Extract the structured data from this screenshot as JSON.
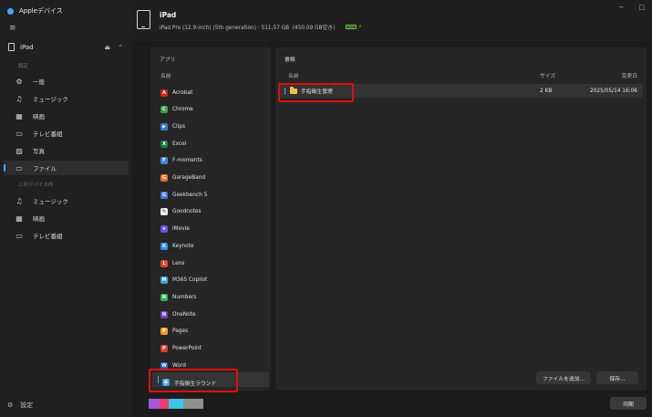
{
  "app": {
    "title": "Appleデバイス"
  },
  "window_controls": {
    "minimize": "−",
    "maximize": "□",
    "close": "✕"
  },
  "sidebar": {
    "device": "iPad",
    "section_settings": "設定",
    "items": [
      {
        "label": "一般",
        "icon": "gear-icon"
      },
      {
        "label": "ミュージック",
        "icon": "music-note-icon"
      },
      {
        "label": "映画",
        "icon": "film-icon"
      },
      {
        "label": "テレビ番組",
        "icon": "tv-icon"
      },
      {
        "label": "写真",
        "icon": "photo-icon"
      },
      {
        "label": "ファイル",
        "icon": "folder-icon",
        "active": true
      }
    ],
    "section_on_device": "このデバイス内",
    "device_items": [
      {
        "label": "ミュージック",
        "icon": "music-note-icon"
      },
      {
        "label": "映画",
        "icon": "film-icon"
      },
      {
        "label": "テレビ番組",
        "icon": "tv-icon"
      }
    ],
    "settings_label": "設定"
  },
  "header": {
    "device_name": "iPad",
    "device_info": "iPad Pro (12.9-inch) (5th generation) · 511.57 GB（450.09 GB空き）"
  },
  "apps_panel": {
    "title": "アプリ",
    "column_name": "名前",
    "apps": [
      {
        "name": "Acrobat",
        "color": "#d9251c",
        "glyph": "A"
      },
      {
        "name": "Chrome",
        "color": "#3c9f44",
        "glyph": "C"
      },
      {
        "name": "Clips",
        "color": "#2f7bd6",
        "glyph": "▶"
      },
      {
        "name": "Excel",
        "color": "#1f7a45",
        "glyph": "X"
      },
      {
        "name": "F-moments",
        "color": "#3a86e8",
        "glyph": "F"
      },
      {
        "name": "GarageBand",
        "color": "#f06b2a",
        "glyph": "G"
      },
      {
        "name": "Geekbench 5",
        "color": "#3a7bd5",
        "glyph": "G"
      },
      {
        "name": "Goodnotes",
        "color": "#e8e8e8",
        "glyph": "✎"
      },
      {
        "name": "iMovie",
        "color": "#6b4de6",
        "glyph": "★"
      },
      {
        "name": "Keynote",
        "color": "#2b8ff0",
        "glyph": "K"
      },
      {
        "name": "Lens",
        "color": "#e2442f",
        "glyph": "L"
      },
      {
        "name": "M365 Copilot",
        "color": "#39a3d9",
        "glyph": "M"
      },
      {
        "name": "Numbers",
        "color": "#2cb24c",
        "glyph": "N"
      },
      {
        "name": "OneNote",
        "color": "#7b3fc4",
        "glyph": "N"
      },
      {
        "name": "Pages",
        "color": "#f39a1e",
        "glyph": "P"
      },
      {
        "name": "PowerPoint",
        "color": "#d4452b",
        "glyph": "P"
      },
      {
        "name": "Word",
        "color": "#2a62c9",
        "glyph": "W"
      },
      {
        "name": "手指衛生ラウンド",
        "color": "#3aa0e0",
        "glyph": "手",
        "selected": true
      }
    ]
  },
  "docs_panel": {
    "title": "書類",
    "columns": {
      "name": "名前",
      "size": "サイズ",
      "modified": "変更日"
    },
    "rows": [
      {
        "name": "手指衛生管理",
        "size": "2 KB",
        "modified": "2025/05/14 16:06"
      }
    ],
    "add_file_button": "ファイルを追加...",
    "save_button": "保存..."
  },
  "storage_bar": {
    "segments": [
      {
        "color": "#a35ad8"
      },
      {
        "color": "#ee3b6f"
      },
      {
        "color": "#3cc6e8"
      },
      {
        "color": "#8f8f8f"
      }
    ]
  },
  "sync_button": "同期"
}
